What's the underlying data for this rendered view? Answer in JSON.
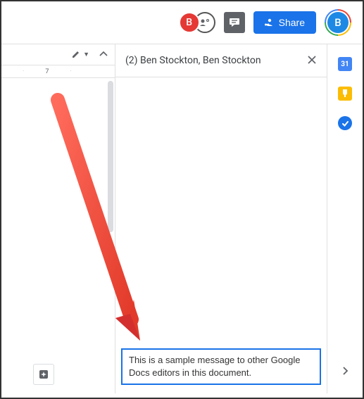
{
  "header": {
    "collab_letter": "B",
    "share_label": "Share",
    "profile_letter": "B"
  },
  "toolbar": {
    "edit_dropdown": "▼"
  },
  "ruler": {
    "mark": "7"
  },
  "chat": {
    "title": "(2) Ben Stockton, Ben Stockton",
    "input_value": "This is a sample message to other Google Docs editors in this document."
  },
  "sidepanel": {
    "calendar": "31"
  }
}
